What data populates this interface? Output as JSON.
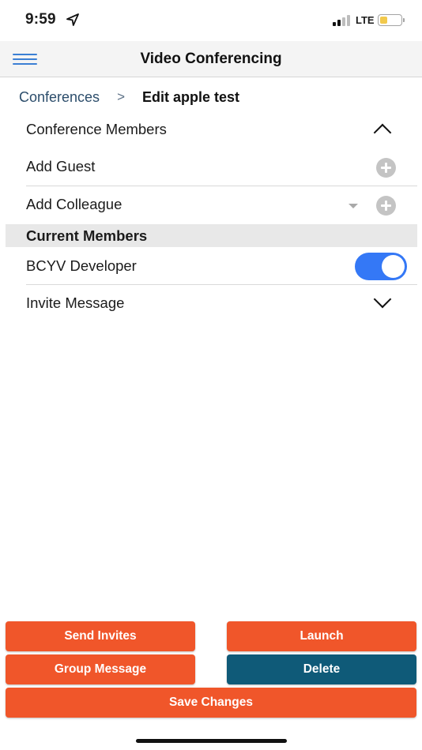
{
  "status_bar": {
    "time": "9:59",
    "network": "LTE",
    "location_icon": "location-arrow-icon",
    "battery_color": "#f2c94c"
  },
  "nav": {
    "title": "Video Conferencing",
    "menu_icon": "hamburger-menu-icon"
  },
  "breadcrumb": {
    "parent": "Conferences",
    "separator": ">",
    "current": "Edit apple test"
  },
  "sections": {
    "conference_members": {
      "label": "Conference Members",
      "expanded": true
    },
    "add_guest": {
      "label": "Add Guest"
    },
    "add_colleague": {
      "label": "Add Colleague"
    },
    "current_members": {
      "header": "Current Members"
    },
    "members": [
      {
        "name": "BCYV Developer",
        "included": true
      }
    ],
    "invite_message": {
      "label": "Invite Message",
      "expanded": false
    }
  },
  "buttons": {
    "send_invites": "Send Invites",
    "launch": "Launch",
    "group_message": "Group Message",
    "delete": "Delete",
    "save_changes": "Save Changes"
  },
  "colors": {
    "accent_blue": "#3b7fd4",
    "toggle_on": "#3478f6",
    "primary_orange": "#f0562a",
    "danger_teal": "#0f5a78",
    "nav_bg": "#f4f4f4",
    "section_bg": "#e8e8e8"
  }
}
